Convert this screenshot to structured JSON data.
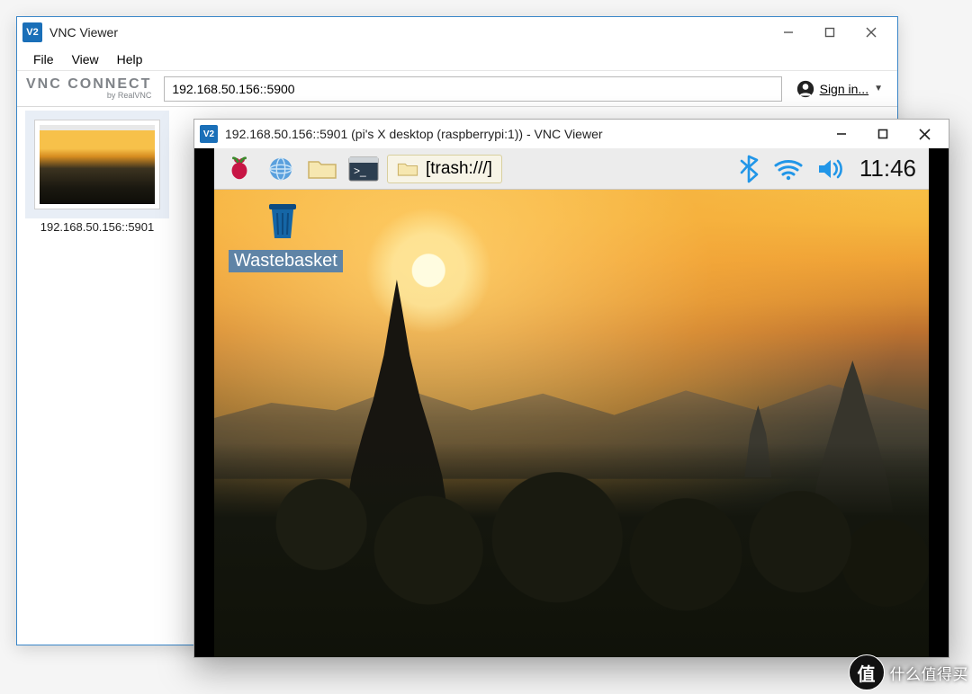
{
  "back_window": {
    "title": "VNC Viewer",
    "menubar": {
      "file": "File",
      "view": "View",
      "help": "Help"
    },
    "brand_line1": "vnc connect",
    "brand_line2": "by RealVNC",
    "address_value": "192.168.50.156::5900",
    "signin_label": "Sign in...",
    "thumb_caption": "192.168.50.156::5901"
  },
  "front_window": {
    "title": "192.168.50.156::5901 (pi's X desktop (raspberrypi:1)) - VNC Viewer"
  },
  "pi_desktop": {
    "task_label": "[trash:///]",
    "clock": "11:46",
    "wastebasket_label": "Wastebasket"
  },
  "watermark": {
    "badge_text": "值",
    "text": "什么值得买"
  }
}
